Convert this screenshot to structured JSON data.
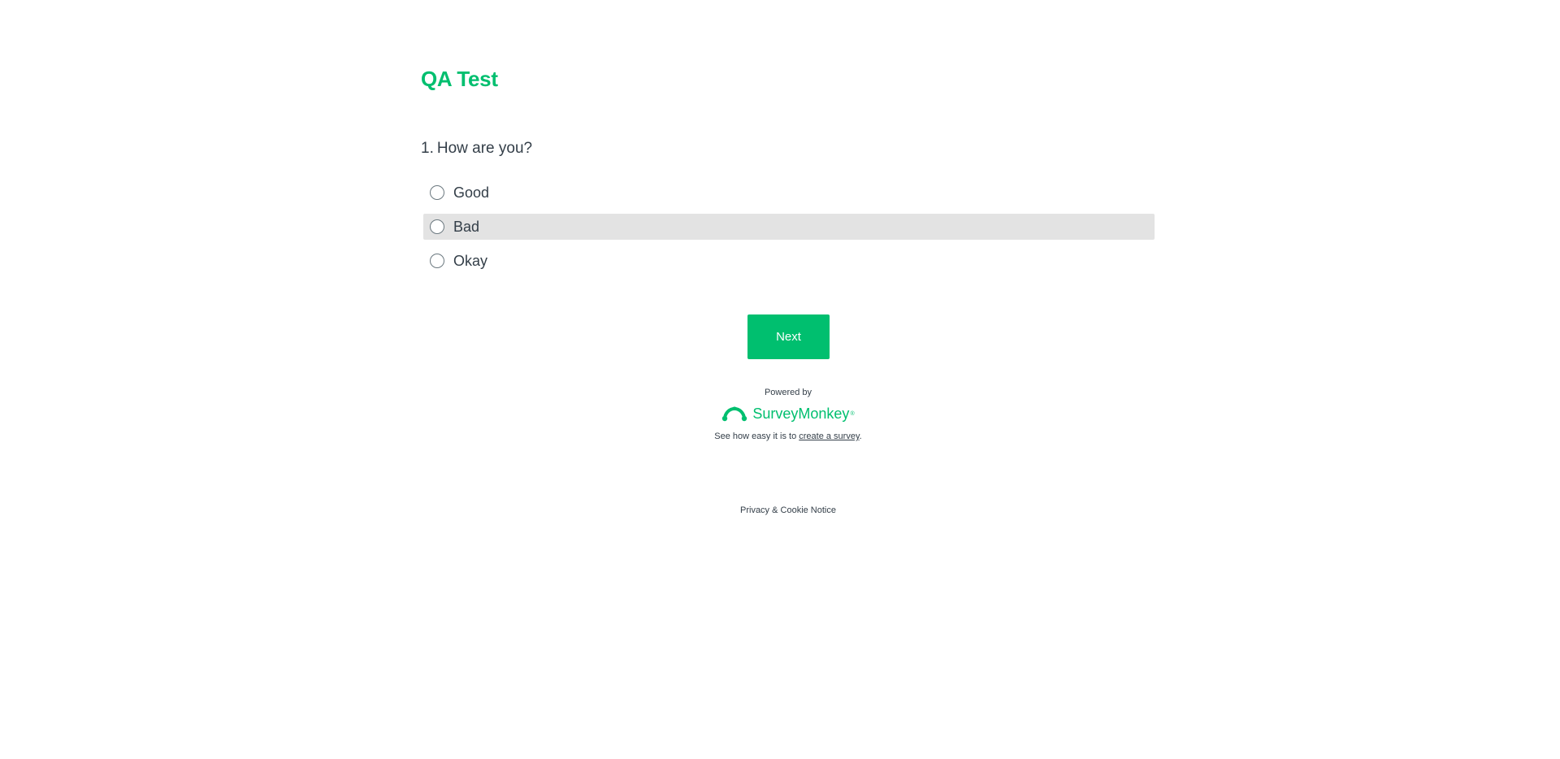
{
  "survey": {
    "title": "QA Test"
  },
  "question": {
    "number": "1.",
    "text": "How are you?",
    "choices": [
      {
        "label": "Good",
        "hovered": false
      },
      {
        "label": "Bad",
        "hovered": true
      },
      {
        "label": "Okay",
        "hovered": false
      }
    ]
  },
  "actions": {
    "next_label": "Next"
  },
  "footer": {
    "powered_by": "Powered by",
    "brand_name": "SurveyMonkey",
    "brand_tm": "®",
    "create_prefix": "See how easy it is to ",
    "create_link": "create a survey",
    "create_suffix": ".",
    "privacy_label": "Privacy & Cookie Notice"
  },
  "colors": {
    "brand_green": "#00bf6f",
    "text_dark": "#333e48",
    "hover_bg": "#e3e3e3"
  }
}
